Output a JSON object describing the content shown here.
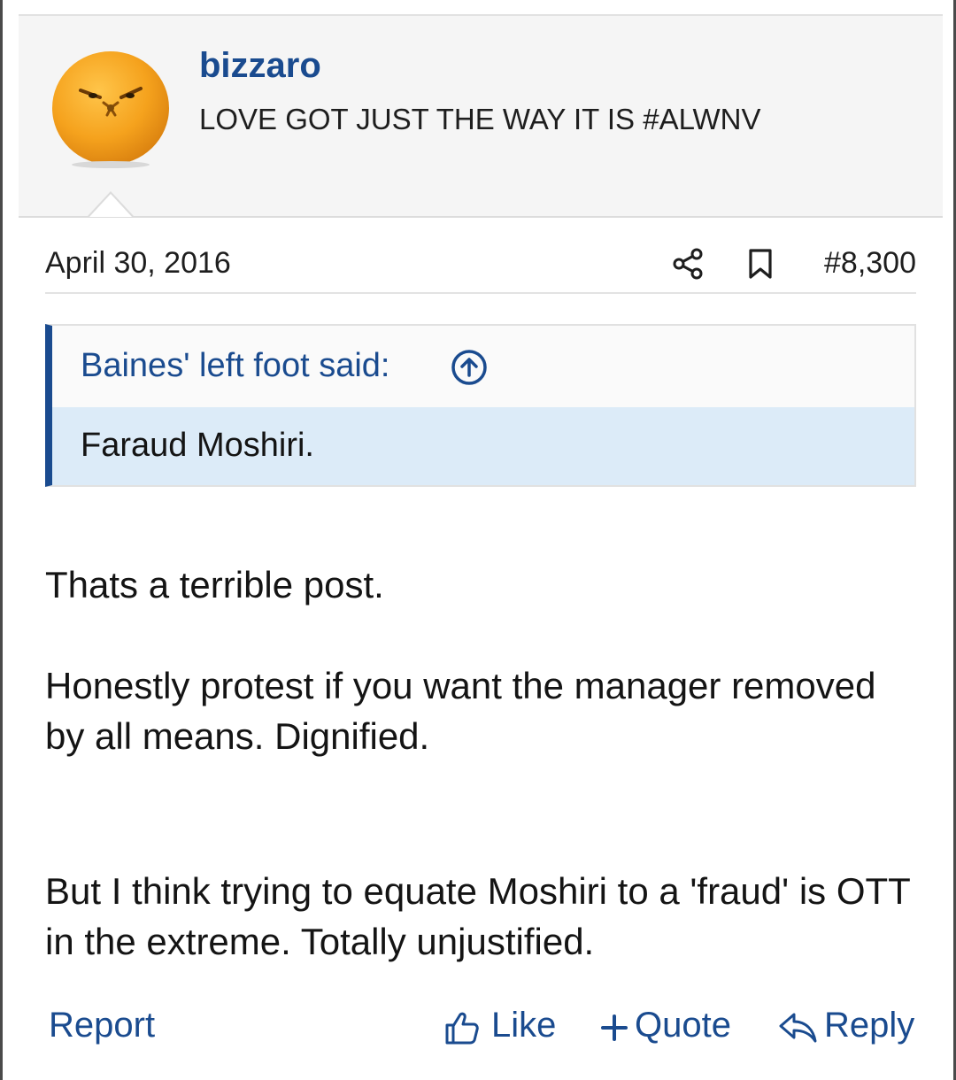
{
  "post": {
    "username": "bizzaro",
    "user_title": "LOVE GOT JUST THE WAY IT IS #ALWNV",
    "date": "April 30, 2016",
    "post_number": "#8,300",
    "quote": {
      "author_label": "Baines' left foot said:",
      "text": "Faraud Moshiri."
    },
    "body": {
      "p1": "Thats a terrible post.",
      "p2": "Honestly protest if you want the manager removed by all means. Dignified.",
      "p3": "But I think trying to equate Moshiri to a 'fraud' is OTT in the extreme. Totally unjustified."
    },
    "actions": {
      "report": "Report",
      "like": "Like",
      "quote": "Quote",
      "reply": "Reply"
    }
  },
  "icons": {
    "avatar": "orange-face-avatar",
    "share": "share-icon",
    "bookmark": "bookmark-icon",
    "quote_jump": "arrow-up-circle-icon",
    "like": "thumbs-up-icon",
    "quote": "plus-icon",
    "reply": "reply-arrow-icon"
  },
  "colors": {
    "link": "#1a4b8f",
    "quote_bg": "#dcebf8",
    "header_bg": "#f5f5f5"
  }
}
